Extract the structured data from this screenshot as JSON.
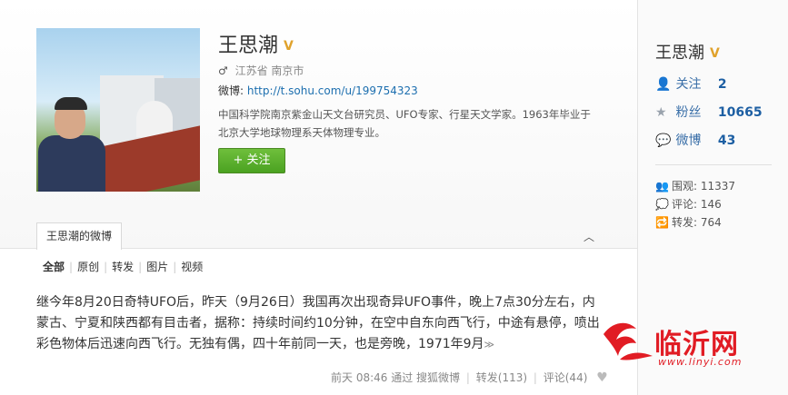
{
  "profile": {
    "name": "王思潮",
    "badge": "V",
    "gender_icon": "♂",
    "location": "江苏省 南京市",
    "weibo_label": "微博:",
    "weibo_url": "http://t.sohu.com/u/199754323",
    "bio": "中国科学院南京紫金山天文台研究员、UFO专家、行星天文学家。1963年毕业于北京大学地球物理系天体物理专业。",
    "follow_label": "+ 关注"
  },
  "tabs": {
    "active": "王思潮的微博",
    "collapse_icon": "chevron-up"
  },
  "filters": [
    "全部",
    "原创",
    "转发",
    "图片",
    "视频"
  ],
  "post": {
    "text": "继今年8月20日奇特UFO后，昨天（9月26日）我国再次出现奇异UFO事件，晚上7点30分左右，内蒙古、宁夏和陕西都有目击者，据称：持续时间约10分钟，在空中自东向西飞行，中途有悬停，喷出彩色物体后迅速向西飞行。无独有偶，四十年前同一天，也是旁晚，1971年9月",
    "more": "≫",
    "time": "前天 08:46",
    "via": "通过 搜狐微博",
    "repost": "转发(113)",
    "comment": "评论(44)"
  },
  "sidebar": {
    "name": "王思潮",
    "badge": "V",
    "stats": [
      {
        "icon": "person-icon",
        "label": "关注",
        "value": "2"
      },
      {
        "icon": "star-icon",
        "label": "粉丝",
        "value": "10665"
      },
      {
        "icon": "speech-icon",
        "label": "微博",
        "value": "43"
      }
    ],
    "small": [
      {
        "icon": "crowd-icon",
        "text": "围观: 11337"
      },
      {
        "icon": "comment-icon",
        "text": "评论: 146"
      },
      {
        "icon": "repost-icon",
        "text": "转发: 764"
      }
    ]
  },
  "watermark": {
    "name": "临沂网",
    "url": "www.linyi.com",
    "color": "#e11c24"
  }
}
